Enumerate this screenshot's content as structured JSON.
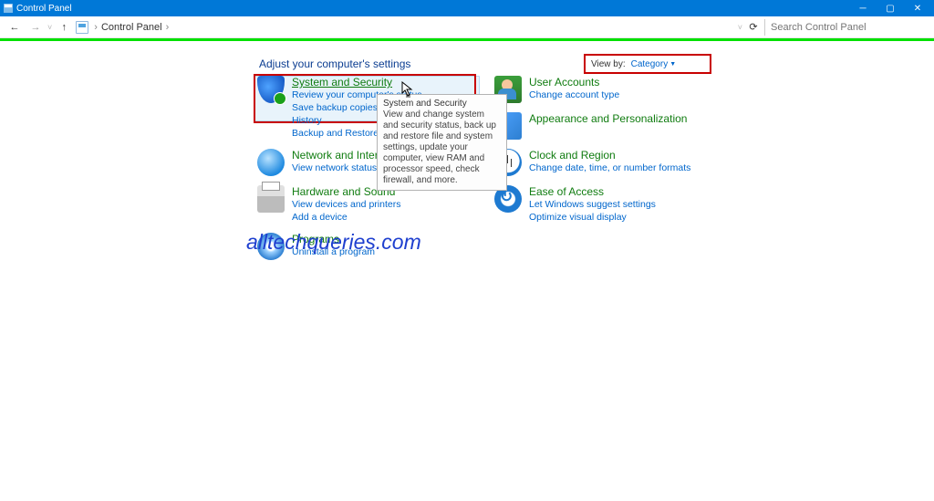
{
  "window": {
    "title": "Control Panel"
  },
  "navbar": {
    "breadcrumb_label": "Control Panel",
    "search_placeholder": "Search Control Panel"
  },
  "page": {
    "heading": "Adjust your computer's settings",
    "viewby_label": "View by:",
    "viewby_value": "Category"
  },
  "left_categories": [
    {
      "title": "System and Security",
      "links": [
        "Review your computer's status",
        "Save backup copies of your files with File History",
        "Backup and Restore (Windows 7)"
      ]
    },
    {
      "title": "Network and Internet",
      "links": [
        "View network status and tasks"
      ]
    },
    {
      "title": "Hardware and Sound",
      "links": [
        "View devices and printers",
        "Add a device"
      ]
    },
    {
      "title": "Programs",
      "links": [
        "Uninstall a program"
      ]
    }
  ],
  "right_categories": [
    {
      "title": "User Accounts",
      "links": [
        "Change account type"
      ]
    },
    {
      "title": "Appearance and Personalization",
      "links": []
    },
    {
      "title": "Clock and Region",
      "links": [
        "Change date, time, or number formats"
      ]
    },
    {
      "title": "Ease of Access",
      "links": [
        "Let Windows suggest settings",
        "Optimize visual display"
      ]
    }
  ],
  "tooltip": {
    "title": "System and Security",
    "body": "View and change system and security status, back up and restore file and system settings, update your computer, view RAM and processor speed, check firewall, and more."
  },
  "watermark": "alltechqueries.com"
}
